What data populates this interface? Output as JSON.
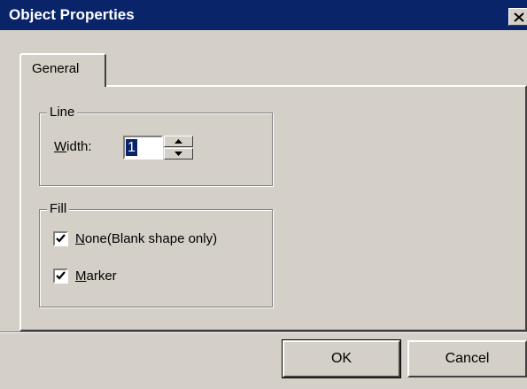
{
  "window": {
    "title": "Object Properties"
  },
  "tabs": [
    {
      "label": "General"
    }
  ],
  "line_group": {
    "legend": "Line",
    "width_label_mnemonic": "W",
    "width_label_rest": "idth:",
    "width_value": "1"
  },
  "fill_group": {
    "legend": "Fill",
    "none_checkbox": {
      "mnemonic": "N",
      "label_rest": "one(Blank shape only)",
      "checked": true
    },
    "marker_checkbox": {
      "mnemonic": "M",
      "label_rest": "arker",
      "checked": true
    }
  },
  "buttons": {
    "ok_label": "OK",
    "cancel_label": "Cancel"
  },
  "colors": {
    "titlebar": "#0a246a",
    "face": "#d4d0c8",
    "selection": "#0a246a"
  },
  "icons": {
    "close": "close-icon",
    "spin_up": "spin-up-arrow-icon",
    "spin_down": "spin-down-arrow-icon",
    "check": "checkmark-icon"
  }
}
